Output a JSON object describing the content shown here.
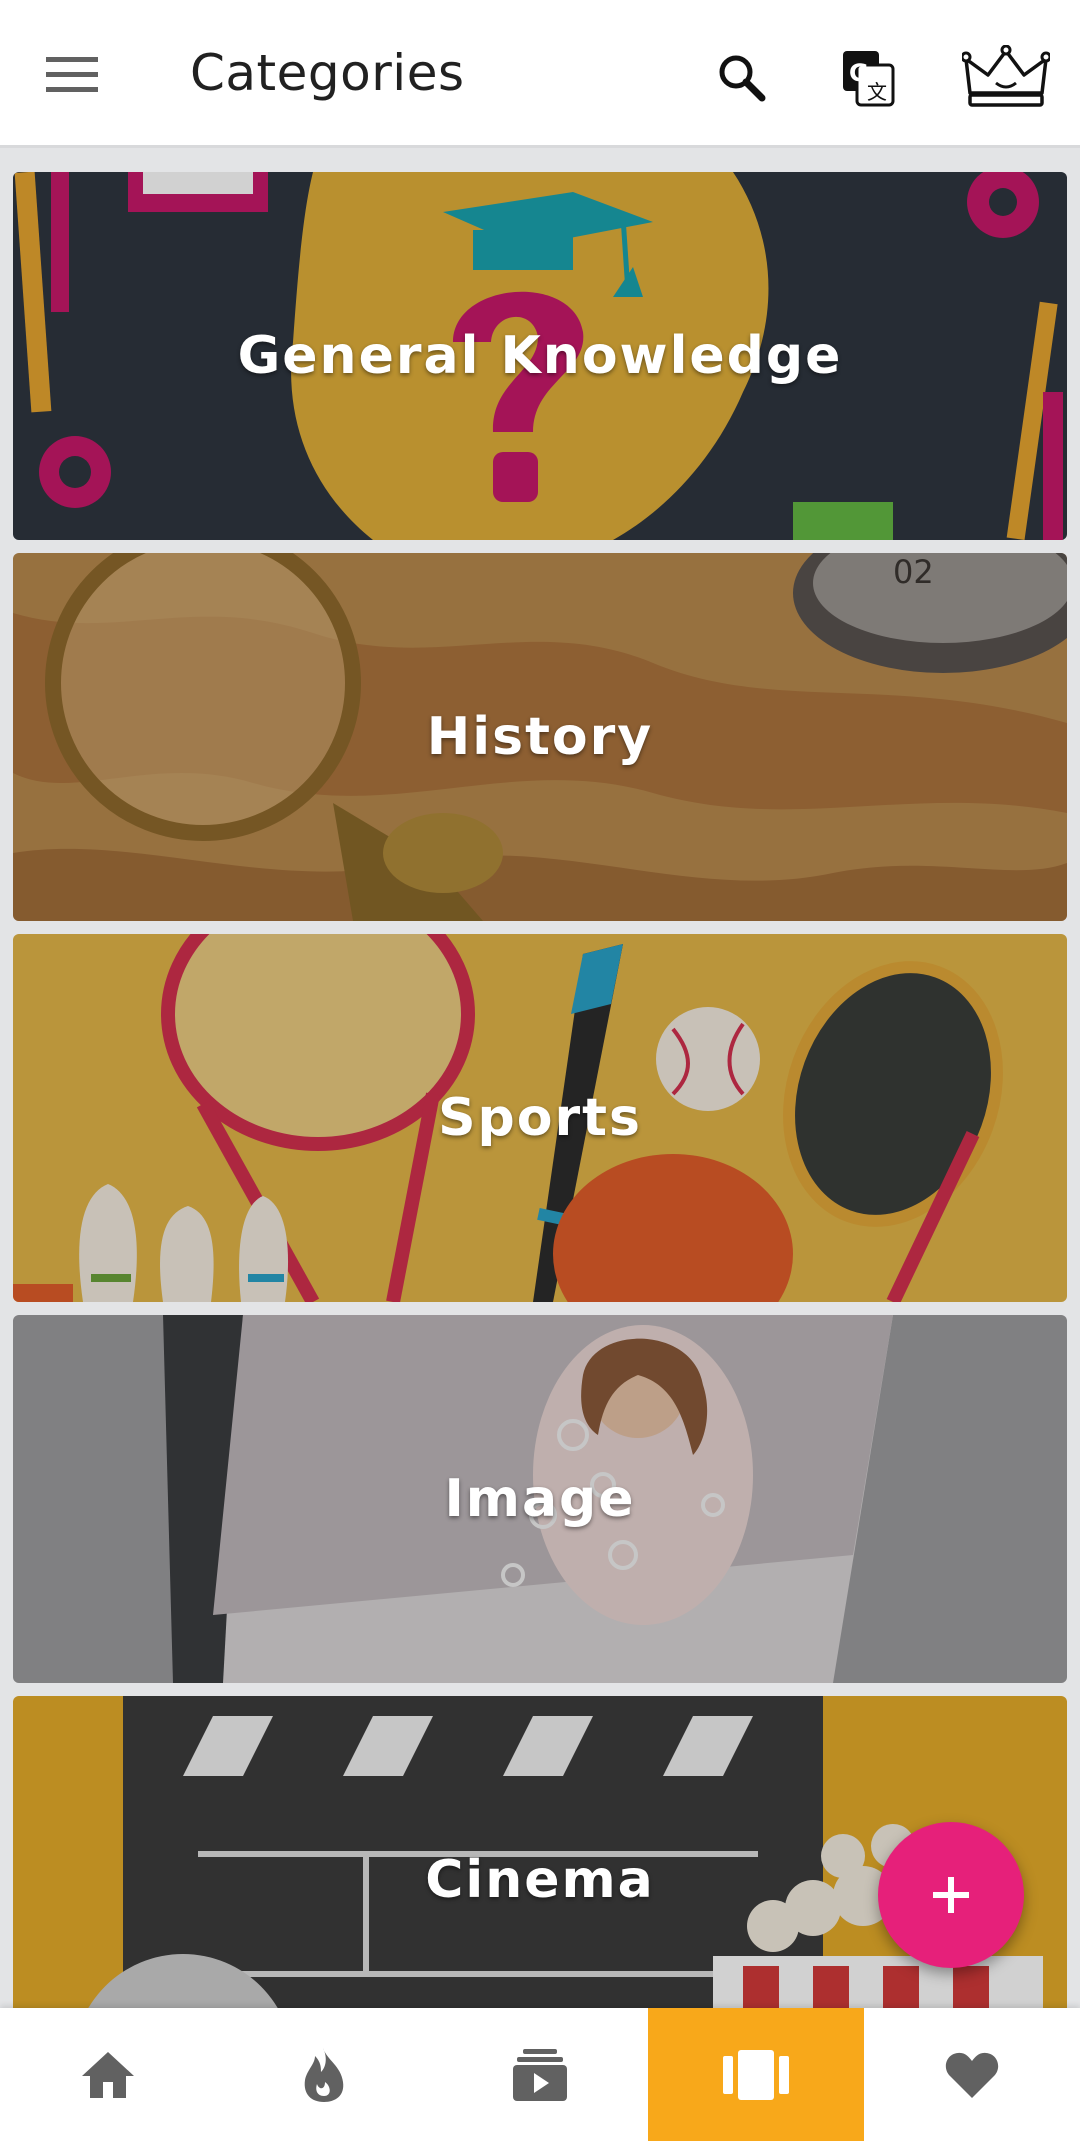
{
  "appbar": {
    "title": "Categories",
    "icons": [
      "menu-icon",
      "search-icon",
      "translate-icon",
      "crown-icon"
    ]
  },
  "categories": [
    {
      "label": "General Knowledge",
      "theme_color": "#2f3640"
    },
    {
      "label": "History",
      "theme_color": "#b98a4e"
    },
    {
      "label": "Sports",
      "theme_color": "#e3b648"
    },
    {
      "label": "Image",
      "theme_color": "#9d9d9f"
    },
    {
      "label": "Cinema",
      "theme_color": "#e6ac2a"
    }
  ],
  "fab": {
    "label": "+"
  },
  "bottom_nav": {
    "items": [
      "home-icon",
      "fire-icon",
      "video-library-icon",
      "categories-icon",
      "heart-icon"
    ],
    "active_index": 3
  },
  "colors": {
    "accent": "#e6207a",
    "active_tab": "#f8a81a",
    "icon_gray": "#616161"
  }
}
